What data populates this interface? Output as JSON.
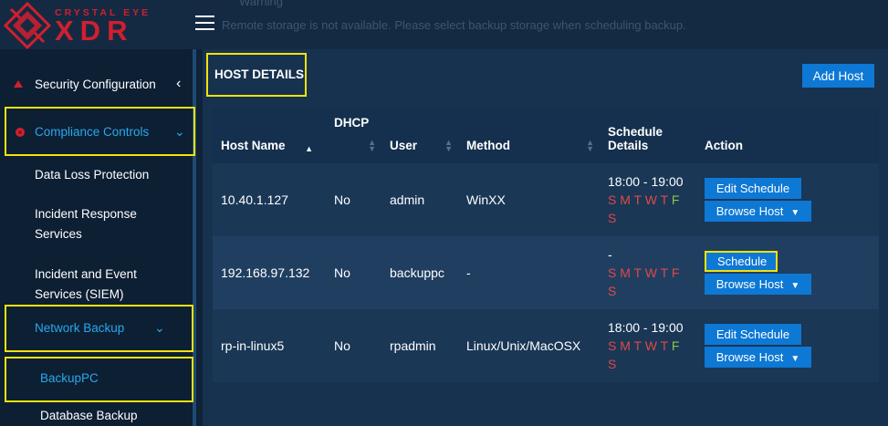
{
  "header": {
    "logo_top": "CRYSTAL EYE",
    "logo_main": "XDR",
    "warning_title": "Warning",
    "warning_text": "Remote storage is not available. Please select backup storage when scheduling backup."
  },
  "sidebar": {
    "items": [
      {
        "label": "Security Configuration",
        "icon": "triangle-up-icon"
      },
      {
        "label": "Compliance Controls",
        "icon": "circle-icon"
      },
      {
        "label": "Data Loss Protection"
      },
      {
        "label": "Incident Response Services"
      },
      {
        "label": "Incident and Event Services (SIEM)"
      },
      {
        "label": "Network Backup"
      },
      {
        "label": "BackupPC"
      },
      {
        "label": "Database Backup"
      }
    ]
  },
  "panel": {
    "title": "HOST DETAILS",
    "add_host_label": "Add Host"
  },
  "table": {
    "headers": {
      "host_name": "Host Name",
      "dhcp": "DHCP",
      "user": "User",
      "method": "Method",
      "schedule_line1": "Schedule",
      "schedule_line2": "Details",
      "action": "Action"
    },
    "rows": [
      {
        "host": "10.40.1.127",
        "dhcp": "No",
        "user": "admin",
        "method": "WinXX",
        "time": "18:00 - 19:00",
        "action_primary": "Edit Schedule",
        "action_secondary": "Browse Host"
      },
      {
        "host": "192.168.97.132",
        "dhcp": "No",
        "user": "backuppc",
        "method": "-",
        "time": "-",
        "action_primary": "Schedule",
        "action_secondary": "Browse Host"
      },
      {
        "host": "rp-in-linux5",
        "dhcp": "No",
        "user": "rpadmin",
        "method": "Linux/Unix/MacOSX",
        "time": "18:00 - 19:00",
        "action_primary": "Edit Schedule",
        "action_secondary": "Browse Host"
      }
    ],
    "days": [
      "S",
      "M",
      "T",
      "W",
      "T",
      "F",
      "S"
    ]
  },
  "colors": {
    "accent": "#0e78d5",
    "highlight": "#f2e20c",
    "day_inactive": "#e04848",
    "day_active": "#8bc34a"
  }
}
